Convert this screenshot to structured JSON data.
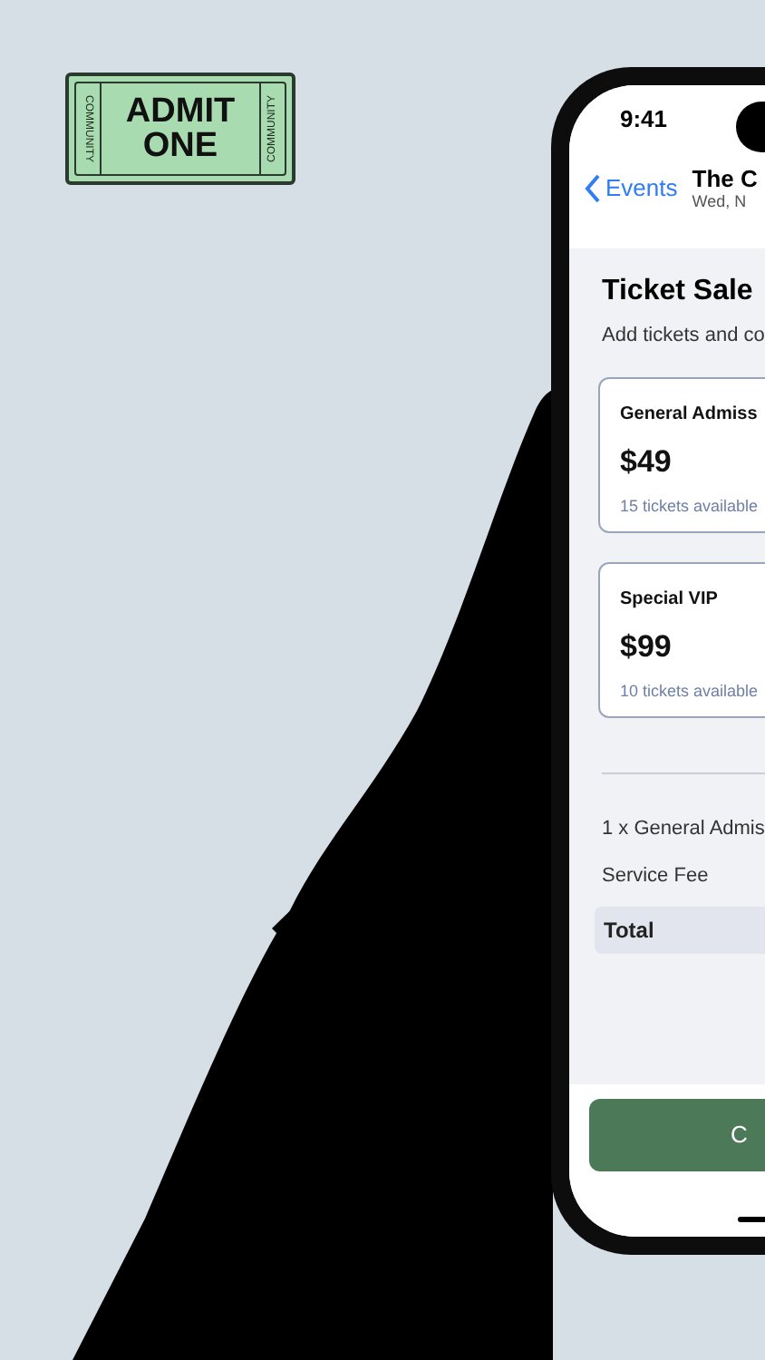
{
  "logo": {
    "lines": [
      "ADMIT",
      "ONE"
    ],
    "side_texts": [
      "COMMUNITY",
      "COMMUNITY"
    ]
  },
  "phone": {
    "status_bar": {
      "time": "9:41"
    },
    "nav_bar": {
      "back": "Events",
      "title": "The C",
      "subtitle": "Wed, N"
    },
    "heading": "Ticket Sale",
    "subheading": "Add tickets and co",
    "tickets": [
      {
        "name": "General Admiss",
        "price": "$49",
        "availability": "15 tickets available"
      },
      {
        "name": "Special VIP",
        "price": "$99",
        "availability": "10 tickets available"
      }
    ],
    "summary": {
      "lines": [
        "1 x General Admis",
        "Service Fee"
      ],
      "total": "Total"
    },
    "button": "C"
  }
}
